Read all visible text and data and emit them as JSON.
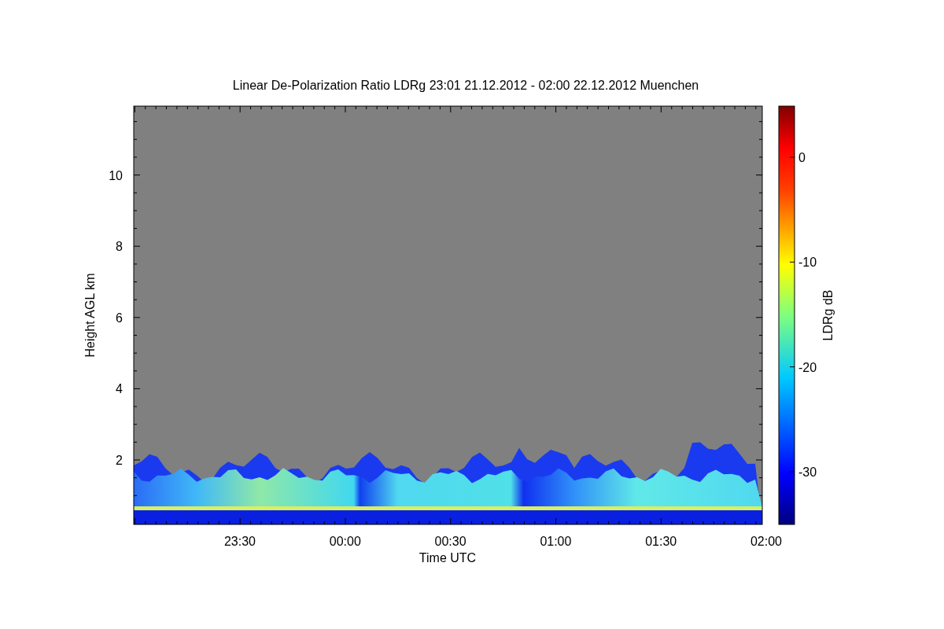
{
  "title": "Linear De-Polarization Ratio LDRg   23:01 21.12.2012 - 02:00 22.12.2012 Muenchen",
  "x_axis": {
    "label": "Time UTC",
    "ticks": [
      "23:30",
      "00:00",
      "00:30",
      "01:00",
      "01:30",
      "02:00"
    ]
  },
  "y_axis": {
    "label": "Height AGL km",
    "ticks": [
      "10",
      "8",
      "6",
      "4",
      "2"
    ]
  },
  "colorbar": {
    "label": "LDRg dB",
    "ticks": [
      "0",
      "-10",
      "-20",
      "-30"
    ]
  }
}
